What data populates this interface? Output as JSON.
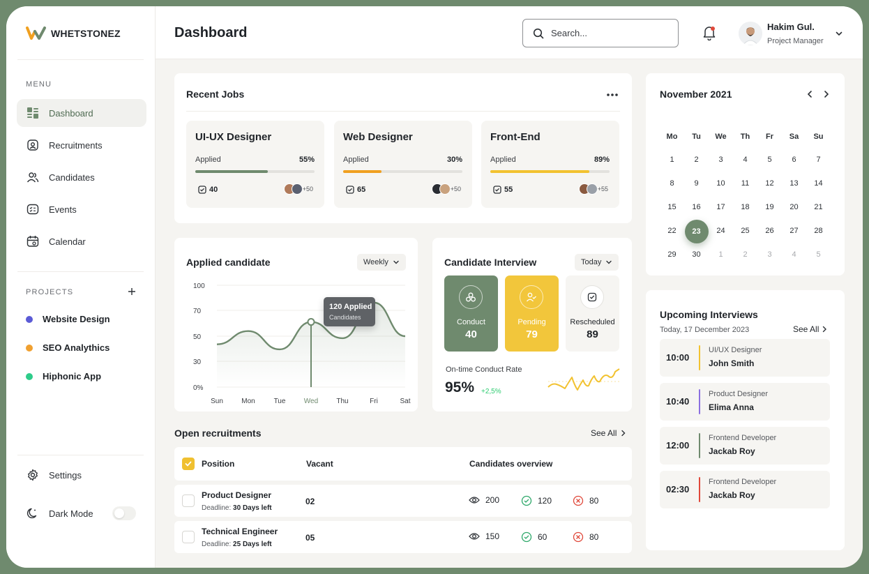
{
  "app": {
    "logo_text": "WHETSTONEZ"
  },
  "header": {
    "title": "Dashboard",
    "search_placeholder": "Search...",
    "user_name": "Hakim Gul.",
    "user_role": "Project Manager"
  },
  "sidebar": {
    "menu_label": "MENU",
    "items": [
      {
        "label": "Dashboard",
        "icon": "dashboard-icon",
        "active": true
      },
      {
        "label": "Recruitments",
        "icon": "recruitments-icon"
      },
      {
        "label": "Candidates",
        "icon": "users-icon"
      },
      {
        "label": "Events",
        "icon": "events-icon"
      },
      {
        "label": "Calendar",
        "icon": "calendar-icon"
      }
    ],
    "projects_label": "PROJECTS",
    "projects": [
      {
        "label": "Website Design",
        "color": "#5b5bd6"
      },
      {
        "label": "SEO Analythics",
        "color": "#f0a030"
      },
      {
        "label": "Hiphonic App",
        "color": "#2ecc8a"
      }
    ],
    "settings_label": "Settings",
    "dark_mode_label": "Dark Mode",
    "dark_mode_on": false
  },
  "recent_jobs": {
    "title": "Recent Jobs",
    "jobs": [
      {
        "title": "UI-UX Designer",
        "applied_label": "Applied",
        "percent": "55%",
        "fill": 0.61,
        "bar_color": "#6f8a6e",
        "count": "40",
        "more": "+50"
      },
      {
        "title": "Web Designer",
        "applied_label": "Applied",
        "percent": "30%",
        "fill": 0.32,
        "bar_color": "#f0a020",
        "count": "65",
        "more": "+50"
      },
      {
        "title": "Front-End",
        "applied_label": "Applied",
        "percent": "89%",
        "fill": 0.83,
        "bar_color": "#f2c230",
        "count": "55",
        "more": "+55"
      }
    ]
  },
  "applied_candidate": {
    "title": "Applied candidate",
    "period": "Weekly",
    "tooltip_value": "120 Applied",
    "tooltip_label": "Candidates"
  },
  "chart_data": {
    "type": "area",
    "categories": [
      "Sun",
      "Mon",
      "Tue",
      "Wed",
      "Thu",
      "Fri",
      "Sat"
    ],
    "y_ticks": [
      "100",
      "70",
      "50",
      "30",
      "0%"
    ],
    "values": [
      42,
      55,
      37,
      64,
      48,
      83,
      50
    ],
    "highlight_index": 3,
    "color": "#6f8a6e"
  },
  "interview": {
    "title": "Candidate Interview",
    "period": "Today",
    "tiles": [
      {
        "label": "Conduct",
        "value": "40",
        "bg": "#6f8a6e"
      },
      {
        "label": "Pending",
        "value": "79",
        "bg": "#f2c63b"
      },
      {
        "label": "Rescheduled",
        "value": "89",
        "bg": "#f6f5f2"
      }
    ],
    "rate_label": "On-time Conduct Rate",
    "rate_value": "95%",
    "rate_change": "+2,5%"
  },
  "open_recruitments": {
    "title": "Open recruitments",
    "see_all": "See All",
    "columns": [
      "Position",
      "Vacant",
      "Candidates overview"
    ],
    "rows": [
      {
        "position": "Product Designer",
        "deadline_label": "Deadline:",
        "deadline": "30 Days left",
        "vacant": "02",
        "views": "200",
        "accepted": "120",
        "rejected": "80"
      },
      {
        "position": "Technical Engineer",
        "deadline_label": "Deadline:",
        "deadline": "25 Days left",
        "vacant": "05",
        "views": "150",
        "accepted": "60",
        "rejected": "80"
      }
    ]
  },
  "calendar": {
    "month": "November 2021",
    "weekdays": [
      "Mo",
      "Tu",
      "We",
      "Th",
      "Fr",
      "Sa",
      "Su"
    ],
    "weeks": [
      [
        "1",
        "2",
        "3",
        "4",
        "5",
        "6",
        "7"
      ],
      [
        "8",
        "9",
        "10",
        "11",
        "12",
        "13",
        "14"
      ],
      [
        "15",
        "16",
        "17",
        "18",
        "19",
        "20",
        "21"
      ],
      [
        "22",
        "23",
        "24",
        "25",
        "26",
        "27",
        "28"
      ],
      [
        "29",
        "30",
        "1",
        "2",
        "3",
        "4",
        "5"
      ]
    ],
    "selected": "23"
  },
  "upcoming": {
    "title": "Upcoming Interviews",
    "date": "Today, 17 December 2023",
    "see_all": "See All",
    "items": [
      {
        "time": "10:00",
        "role": "UI/UX Designer",
        "name": "John Smith",
        "color": "#f2c230"
      },
      {
        "time": "10:40",
        "role": "Product Designer",
        "name": "Elima Anna",
        "color": "#8b6fe0"
      },
      {
        "time": "12:00",
        "role": "Frontend Developer",
        "name": "Jackab Roy",
        "color": "#6f8a6e"
      },
      {
        "time": "02:30",
        "role": "Frontend Developer",
        "name": "Jackab Roy",
        "color": "#e0483a"
      }
    ]
  }
}
